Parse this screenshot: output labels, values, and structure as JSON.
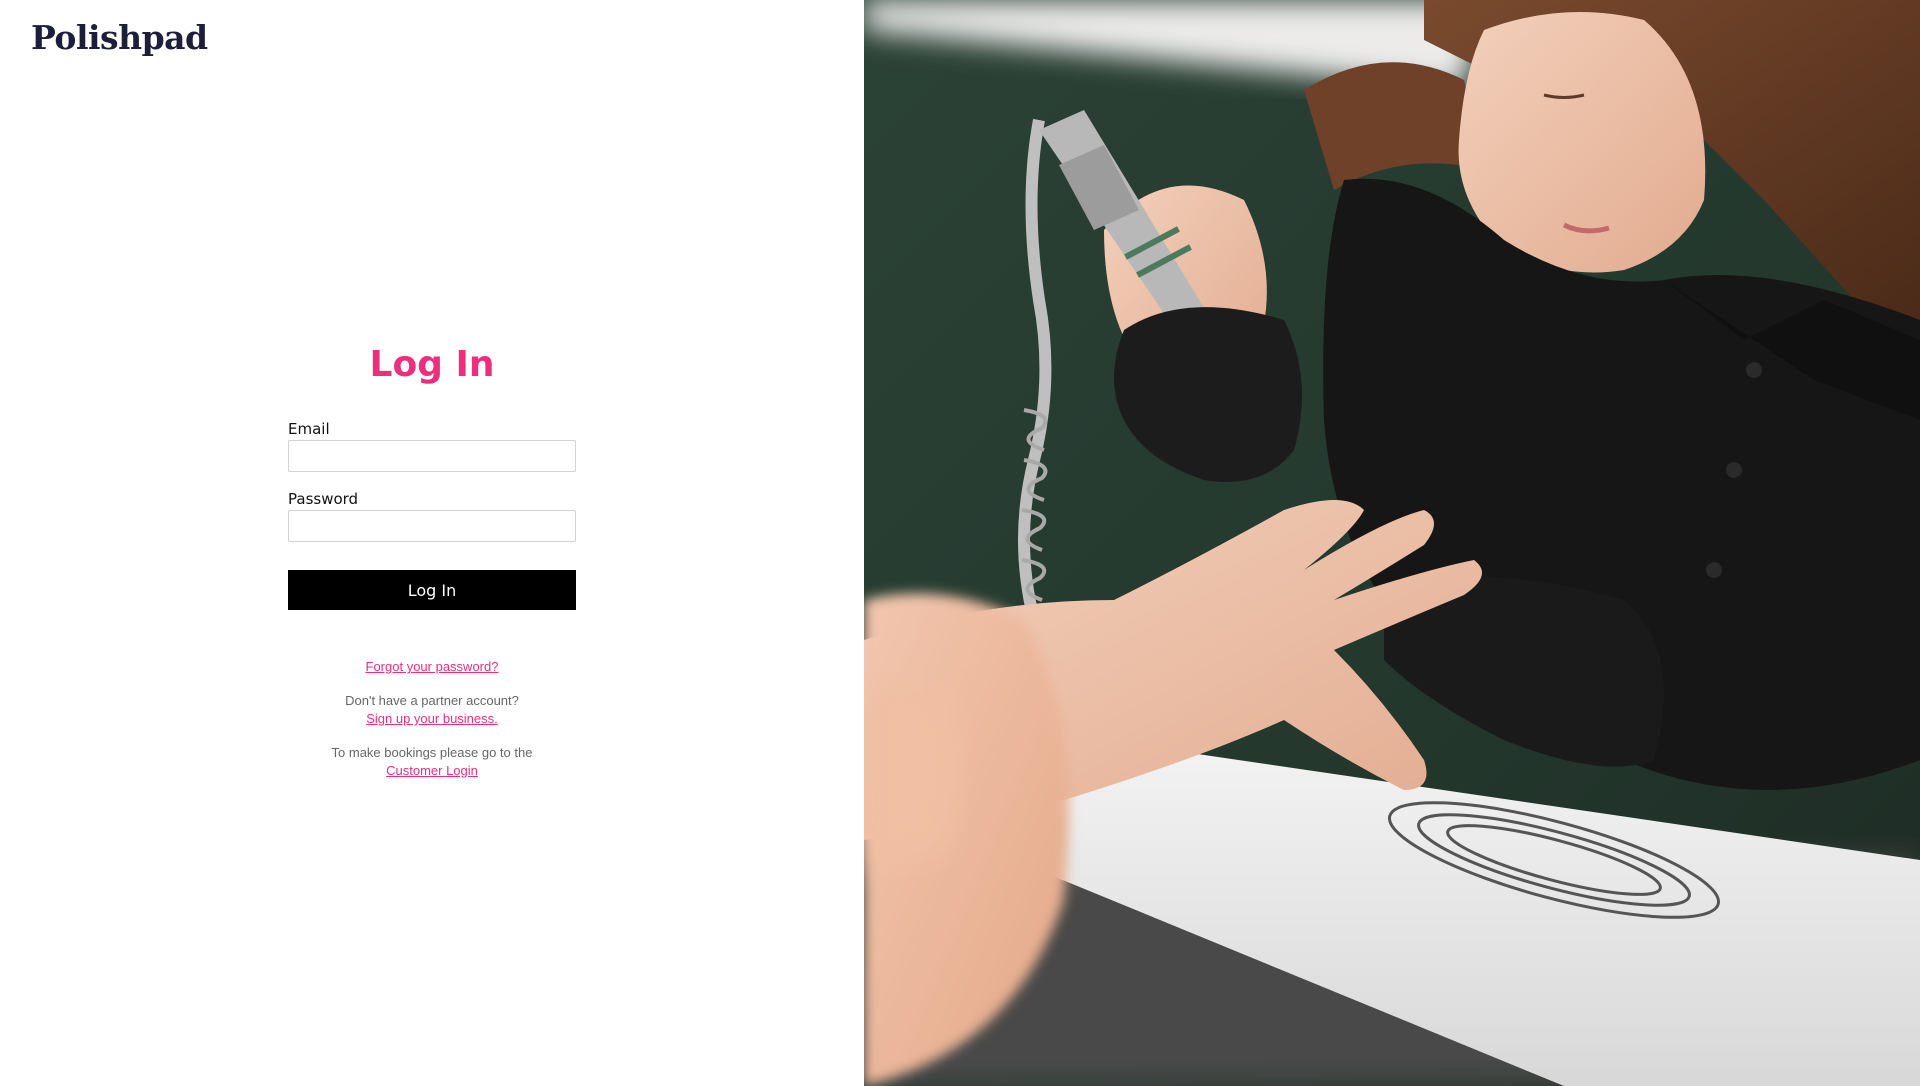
{
  "brand": {
    "logo_text": "Polishpad"
  },
  "login_form": {
    "title": "Log In",
    "email_label": "Email",
    "email_value": "",
    "password_label": "Password",
    "password_value": "",
    "submit_label": "Log In"
  },
  "links": {
    "forgot_password": "Forgot your password?",
    "partner_prompt": "Don't have a partner account?",
    "signup_link": "Sign up your business.",
    "bookings_prompt": "To make bookings please go to the",
    "customer_login_link": "Customer Login"
  },
  "hero_image": {
    "description_icon": "manicure-photo"
  },
  "colors": {
    "accent": "#ec2e7d",
    "logo": "#1d1f3a",
    "button_bg": "#000000",
    "button_text": "#ffffff"
  }
}
